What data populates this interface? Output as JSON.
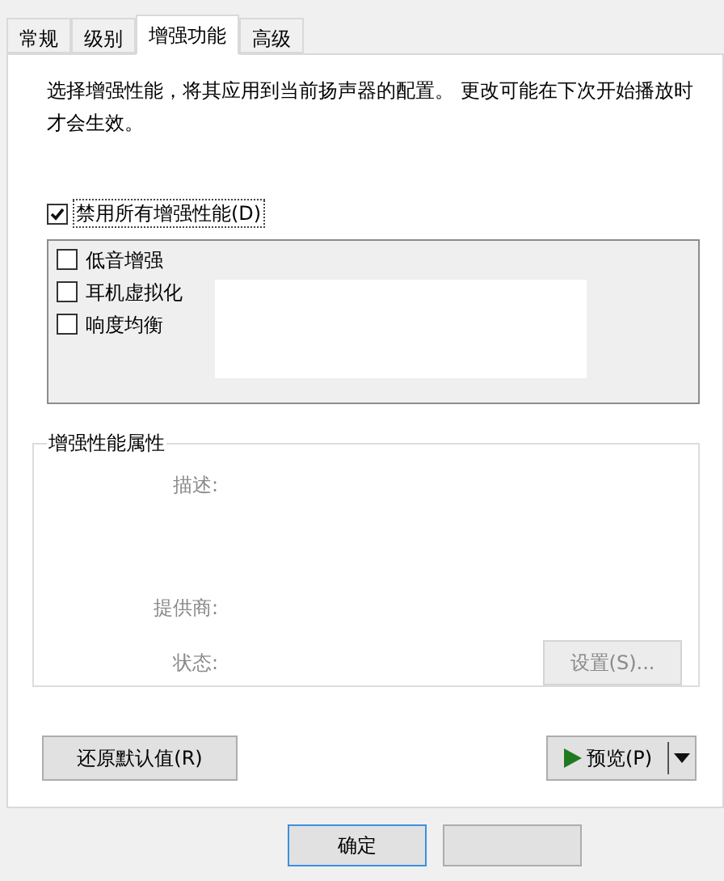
{
  "tabs": [
    {
      "label": "常规",
      "selected": false
    },
    {
      "label": "级别",
      "selected": false
    },
    {
      "label": "增强功能",
      "selected": true
    },
    {
      "label": "高级",
      "selected": false
    }
  ],
  "description": "选择增强性能，将其应用到当前扬声器的配置。 更改可能在下次开始播放时才会生效。",
  "disable_all": {
    "label": "禁用所有增强性能(D)",
    "checked": true
  },
  "enhancements": [
    {
      "label": "低音增强",
      "checked": false
    },
    {
      "label": "耳机虚拟化",
      "checked": false
    },
    {
      "label": "响度均衡",
      "checked": false
    }
  ],
  "properties": {
    "title": "增强性能属性",
    "disabled": true,
    "fields": [
      {
        "label": "描述:"
      },
      {
        "label": "提供商:"
      },
      {
        "label": "状态:"
      }
    ],
    "settings_button": "设置(S)..."
  },
  "restore_button": "还原默认值(R)",
  "preview_button": "预览(P)",
  "dialog_buttons": [
    {
      "label": "确定",
      "selected": true
    }
  ]
}
